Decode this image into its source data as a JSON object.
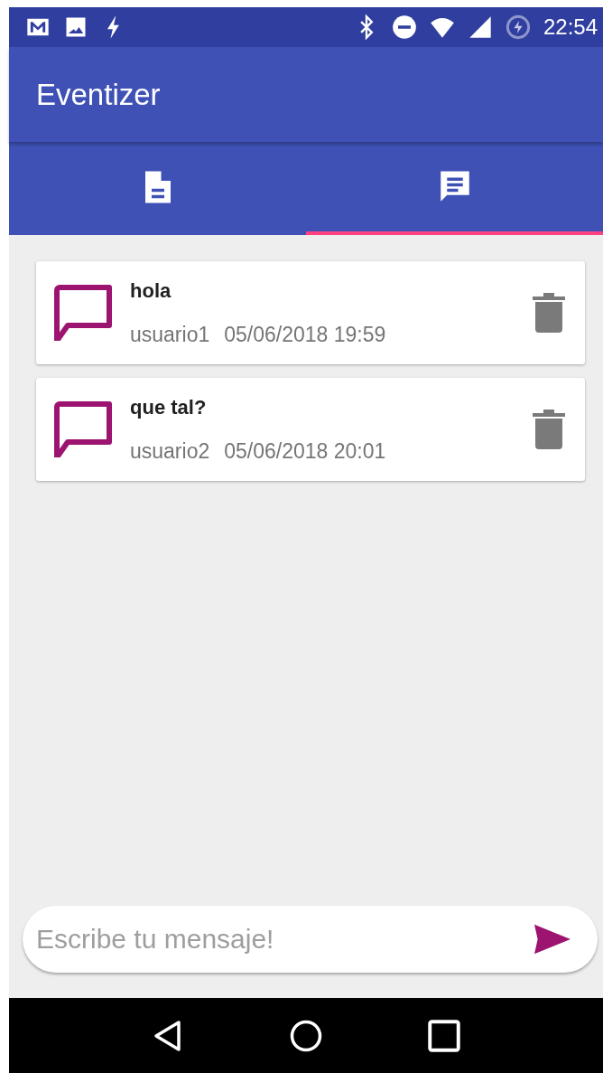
{
  "status_bar": {
    "time": "22:54"
  },
  "app_bar": {
    "title": "Eventizer"
  },
  "tabs": [
    {
      "kind": "document",
      "selected": false
    },
    {
      "kind": "chat",
      "selected": true
    }
  ],
  "messages": [
    {
      "text": "hola",
      "user": "usuario1",
      "date": "05/06/2018 19:59"
    },
    {
      "text": "que tal?",
      "user": "usuario2",
      "date": "05/06/2018 20:01"
    }
  ],
  "composer": {
    "placeholder": "Escribe tu mensaje!"
  }
}
